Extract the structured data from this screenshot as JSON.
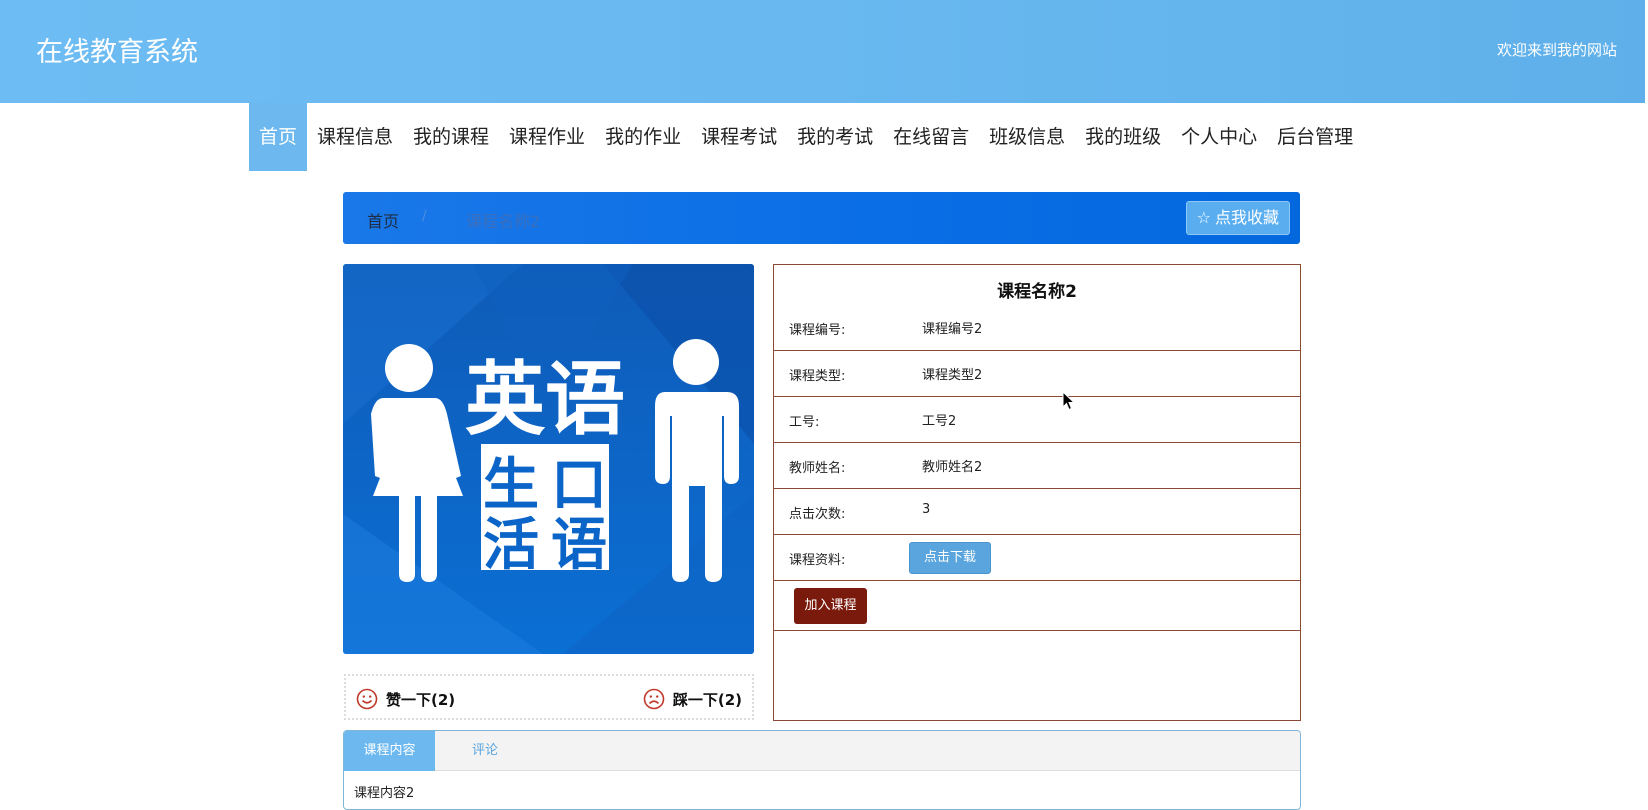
{
  "header": {
    "site_title": "在线教育系统",
    "welcome": "欢迎来到我的网站",
    "gradient_colors": [
      "#6dbcf3",
      "#5fb0ea"
    ]
  },
  "nav": {
    "items": [
      "首页",
      "课程信息",
      "我的课程",
      "课程作业",
      "我的作业",
      "课程考试",
      "我的考试",
      "在线留言",
      "班级信息",
      "我的班级",
      "个人中心",
      "后台管理"
    ],
    "active_index": 0,
    "active_color": "#6cb8ef"
  },
  "breadcrumb": {
    "home": "首页",
    "separator": "/",
    "current": "课程名称2",
    "favorite_label": "点我收藏",
    "favorite_icon": "star-outline-icon"
  },
  "cover": {
    "line1": "英语",
    "line2a": "生",
    "line2b": "口",
    "line3a": "活",
    "line3b": "语",
    "background_color": "#0a5fc4"
  },
  "votes": {
    "like_label": "赞一下(2)",
    "like_icon": "smile-icon",
    "dislike_label": "踩一下(2)",
    "dislike_icon": "frown-icon",
    "icon_color": "#c0392b"
  },
  "info": {
    "title": "课程名称2",
    "rows": [
      {
        "label": "课程编号:",
        "value": "课程编号2"
      },
      {
        "label": "课程类型:",
        "value": "课程类型2"
      },
      {
        "label": "工号:",
        "value": "工号2"
      },
      {
        "label": "教师姓名:",
        "value": "教师姓名2"
      },
      {
        "label": "点击次数:",
        "value": "3"
      },
      {
        "label": "课程资料:",
        "value": ""
      }
    ],
    "download_label": "点击下载",
    "join_label": "加入课程",
    "border_color": "#8b4a35",
    "join_color": "#7a1a0c"
  },
  "tabs": {
    "items": [
      "课程内容",
      "评论"
    ],
    "active_index": 0,
    "content": "课程内容2"
  }
}
